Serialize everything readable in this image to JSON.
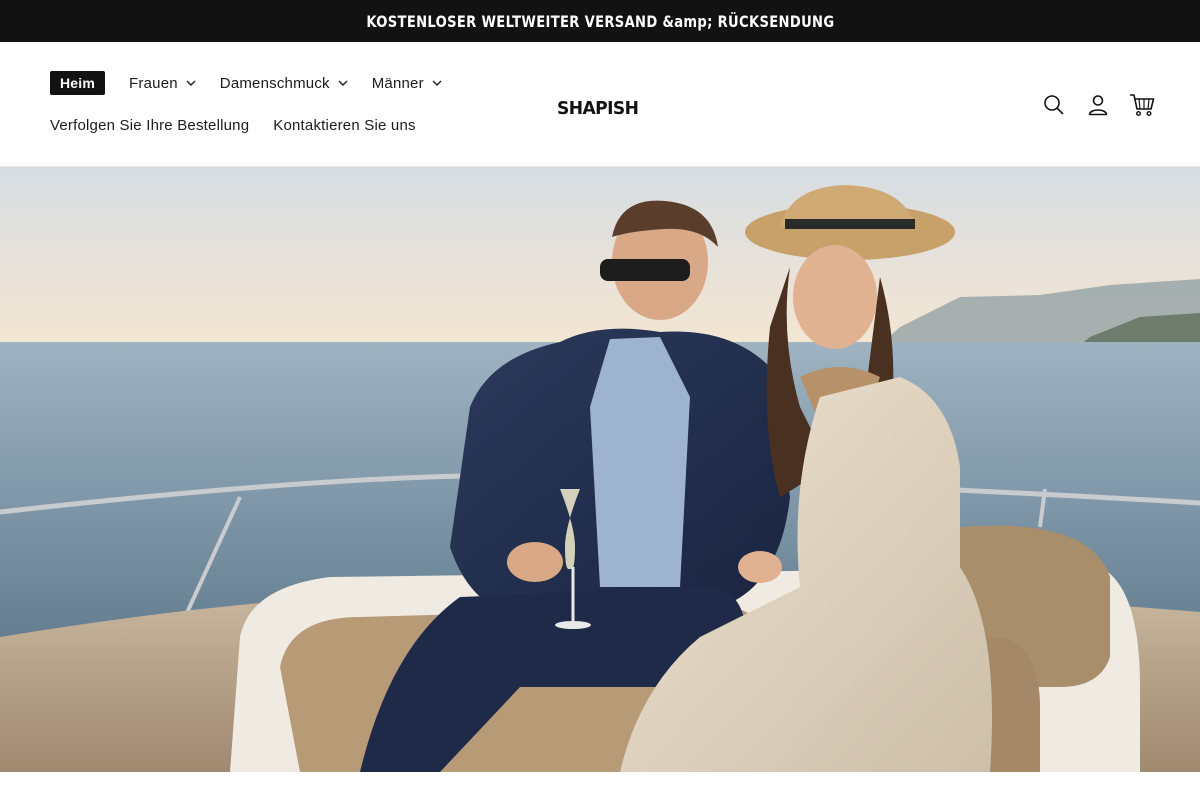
{
  "announcement": {
    "text": "KOSTENLOSER WELTWEITER VERSAND &amp; RÜCKSENDUNG"
  },
  "header": {
    "logo": "SHAPISH",
    "nav": [
      {
        "label": "Heim",
        "active": true,
        "has_dropdown": false
      },
      {
        "label": "Frauen",
        "active": false,
        "has_dropdown": true
      },
      {
        "label": "Damenschmuck",
        "active": false,
        "has_dropdown": true
      },
      {
        "label": "Männer",
        "active": false,
        "has_dropdown": true
      },
      {
        "label": "Verfolgen Sie Ihre Bestellung",
        "active": false,
        "has_dropdown": false
      },
      {
        "label": "Kontaktieren Sie uns",
        "active": false,
        "has_dropdown": false
      }
    ],
    "icons": [
      "search-icon",
      "account-icon",
      "cart-icon"
    ]
  },
  "hero": {
    "image": "couple-on-yacht-at-sunset"
  },
  "colors": {
    "announcement_bg": "#121212",
    "active_nav_bg": "#121212",
    "text": "#121212"
  }
}
